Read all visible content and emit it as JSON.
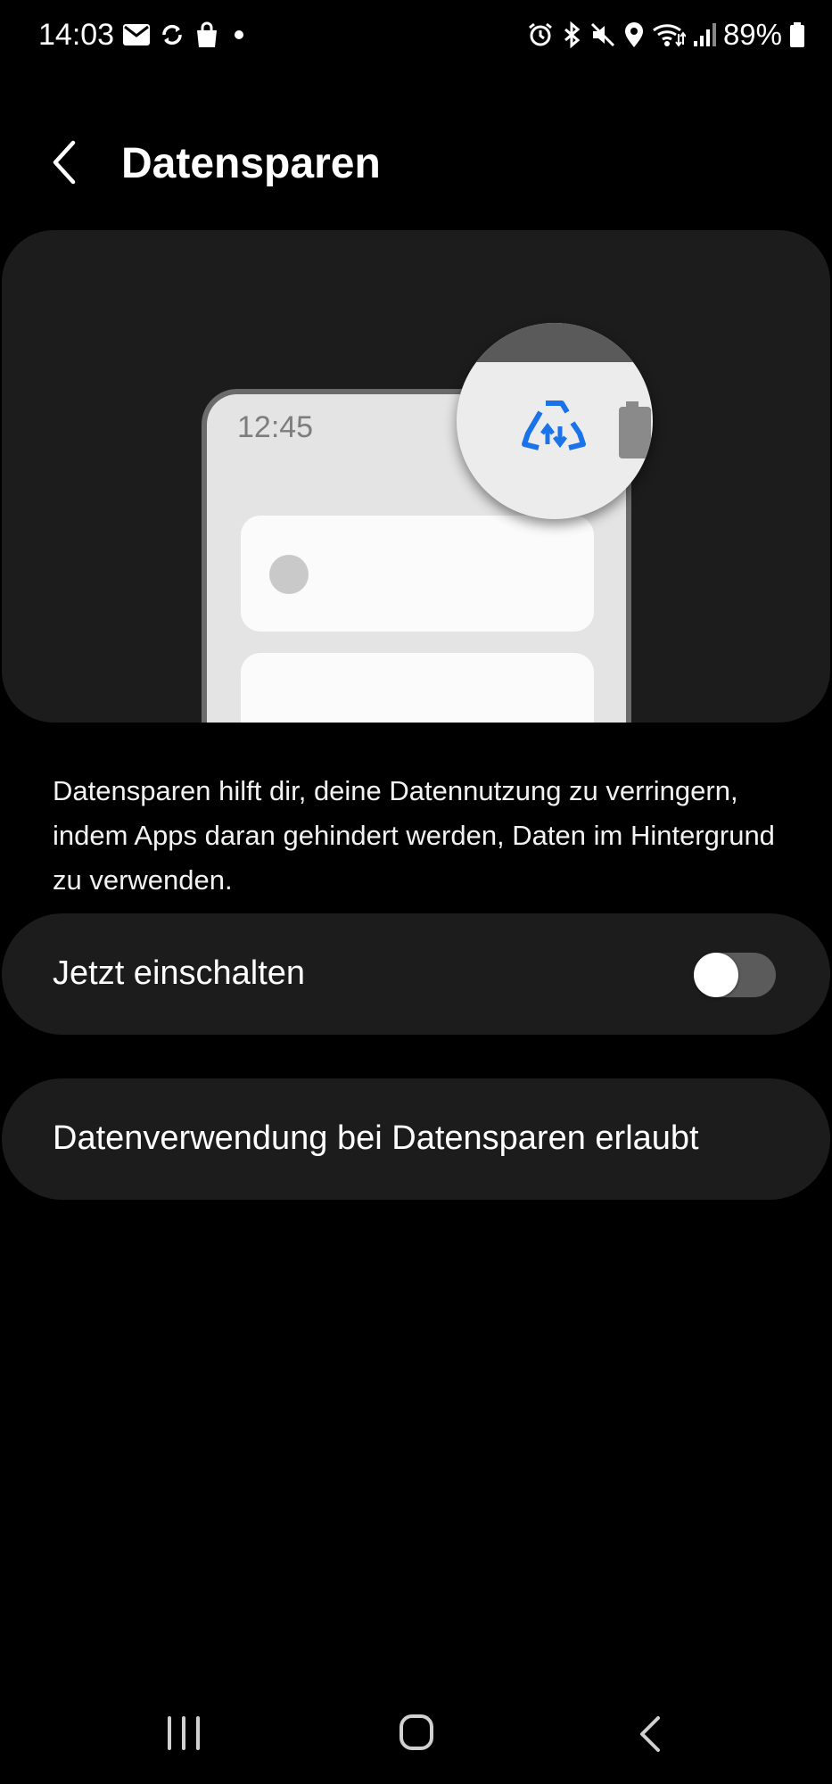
{
  "status_bar": {
    "time": "14:03",
    "battery": "89%",
    "left_icons": [
      "mail-icon",
      "sync-icon",
      "shopping-bag-icon",
      "notification-dot-icon"
    ],
    "right_icons": [
      "alarm-icon",
      "bluetooth-icon",
      "mute-icon",
      "location-icon",
      "wifi-icon",
      "signal-icon",
      "battery-icon"
    ]
  },
  "header": {
    "title": "Datensparen",
    "back_icon": "chevron-left-icon"
  },
  "illustration": {
    "phone_time": "12:45",
    "highlight_icon": "data-saver-icon",
    "accent_color": "#1a73e8"
  },
  "description": "Datensparen hilft dir, deine Datennutzung zu verringern, indem Apps daran gehindert werden, Daten im Hintergrund zu verwenden.",
  "toggle": {
    "label": "Jetzt einschalten",
    "state": "off"
  },
  "allowed_item": {
    "label": "Datenverwendung bei Datensparen erlaubt"
  },
  "nav_bar": {
    "icons": [
      "recents-icon",
      "home-icon",
      "back-icon"
    ]
  }
}
